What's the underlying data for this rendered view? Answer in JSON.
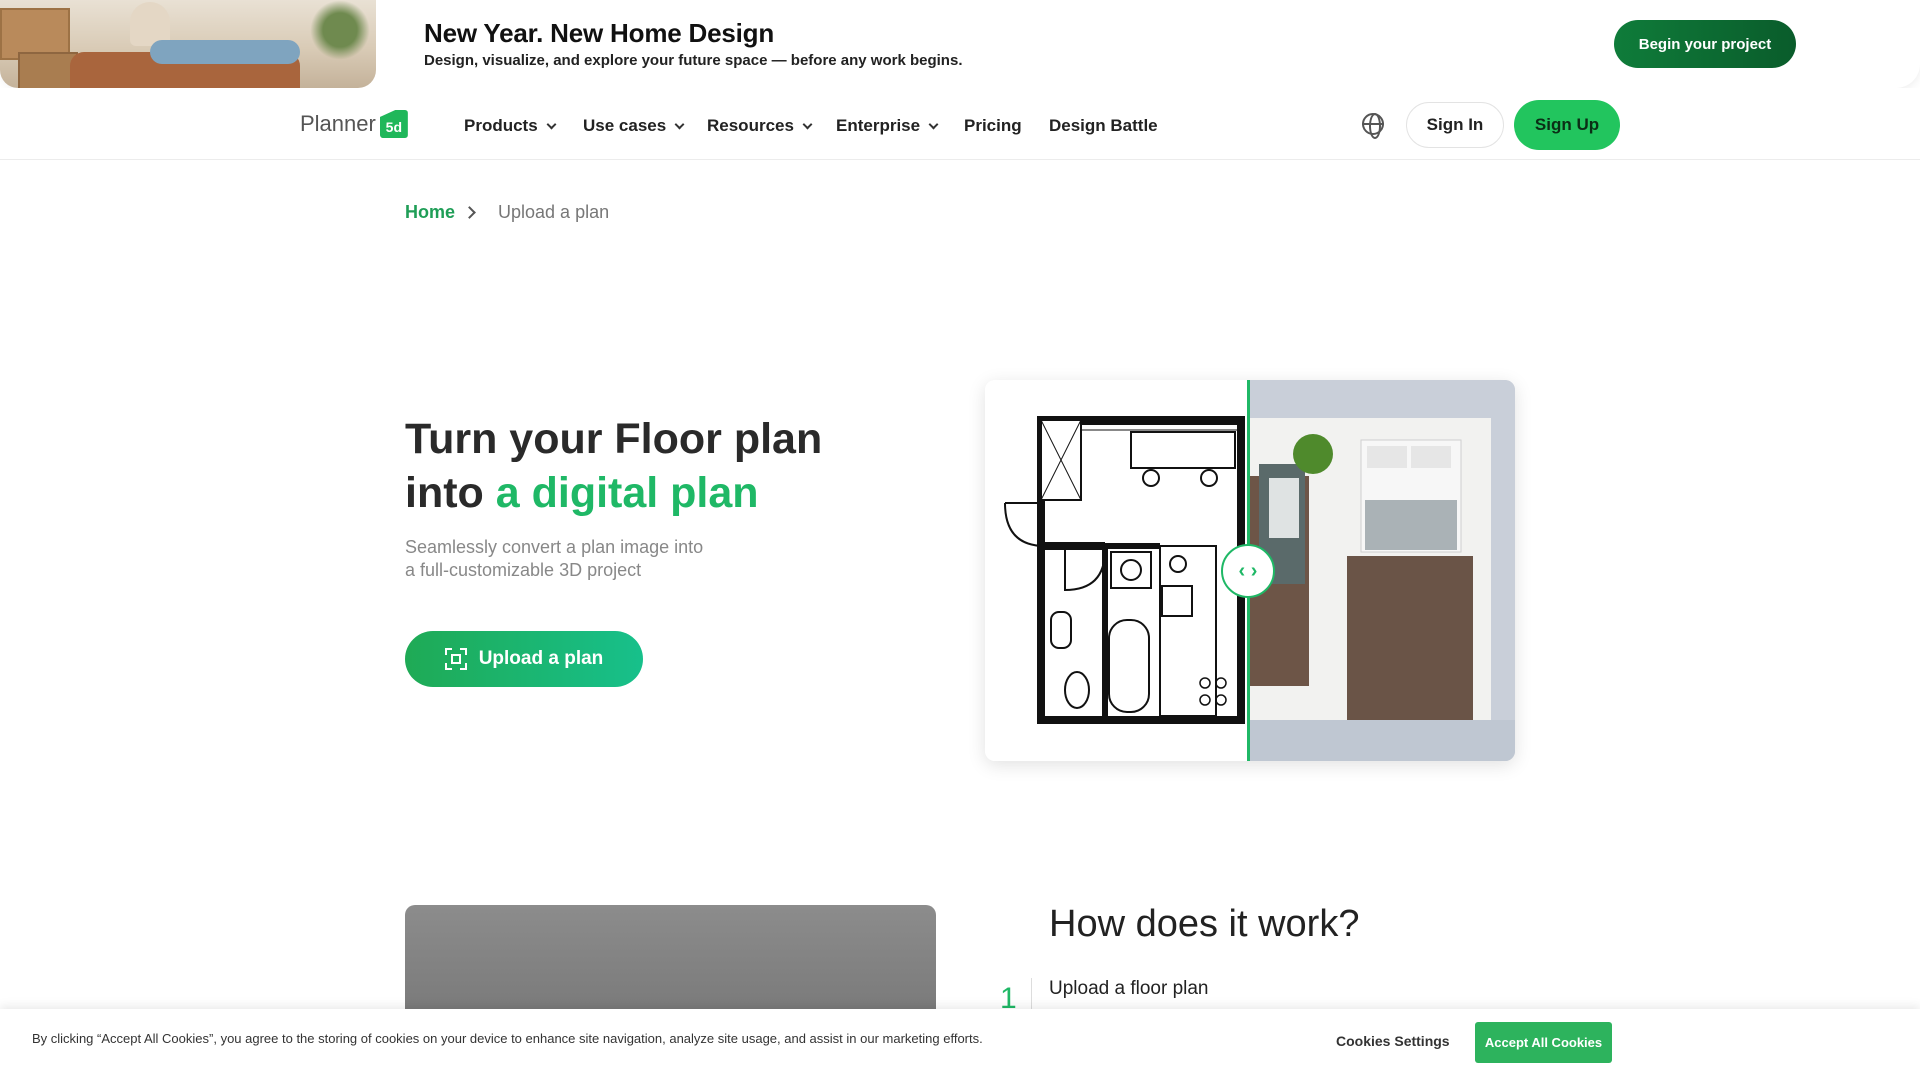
{
  "promo": {
    "title": "New Year. New Home Design",
    "subtitle": "Design, visualize, and explore your future space — before any work begins.",
    "cta": "Begin your project"
  },
  "nav": {
    "logo_text": "Planner",
    "logo_mark": "5d",
    "items": [
      {
        "label": "Products",
        "has_dropdown": true
      },
      {
        "label": "Use cases",
        "has_dropdown": true
      },
      {
        "label": "Resources",
        "has_dropdown": true
      },
      {
        "label": "Enterprise",
        "has_dropdown": true
      },
      {
        "label": "Pricing",
        "has_dropdown": false
      },
      {
        "label": "Design Battle",
        "has_dropdown": false
      }
    ],
    "language_icon": "globe-icon",
    "sign_in": "Sign In",
    "sign_up": "Sign Up"
  },
  "breadcrumb": {
    "home": "Home",
    "current": "Upload a plan"
  },
  "hero": {
    "title_line1": "Turn your Floor plan",
    "title_line2_prefix": "into ",
    "title_line2_accent": "a digital plan",
    "subtitle_line1": "Seamlessly convert a plan image into",
    "subtitle_line2": "a full-customizable 3D project",
    "button": "Upload a plan",
    "compare_handle": "‹ ›"
  },
  "how": {
    "title": "How does it work?",
    "steps": [
      {
        "number": "1",
        "title": "Upload a floor plan"
      }
    ]
  },
  "cookie": {
    "text": "By clicking “Accept All Cookies”, you agree to the storing of cookies on your device to enhance site navigation, analyze site usage, and assist in our marketing efforts.",
    "settings": "Cookies Settings",
    "accept": "Accept All Cookies"
  },
  "colors": {
    "brand_green": "#1fb866",
    "promo_button": "#0f7c3a",
    "signup_button": "#22c55e"
  }
}
